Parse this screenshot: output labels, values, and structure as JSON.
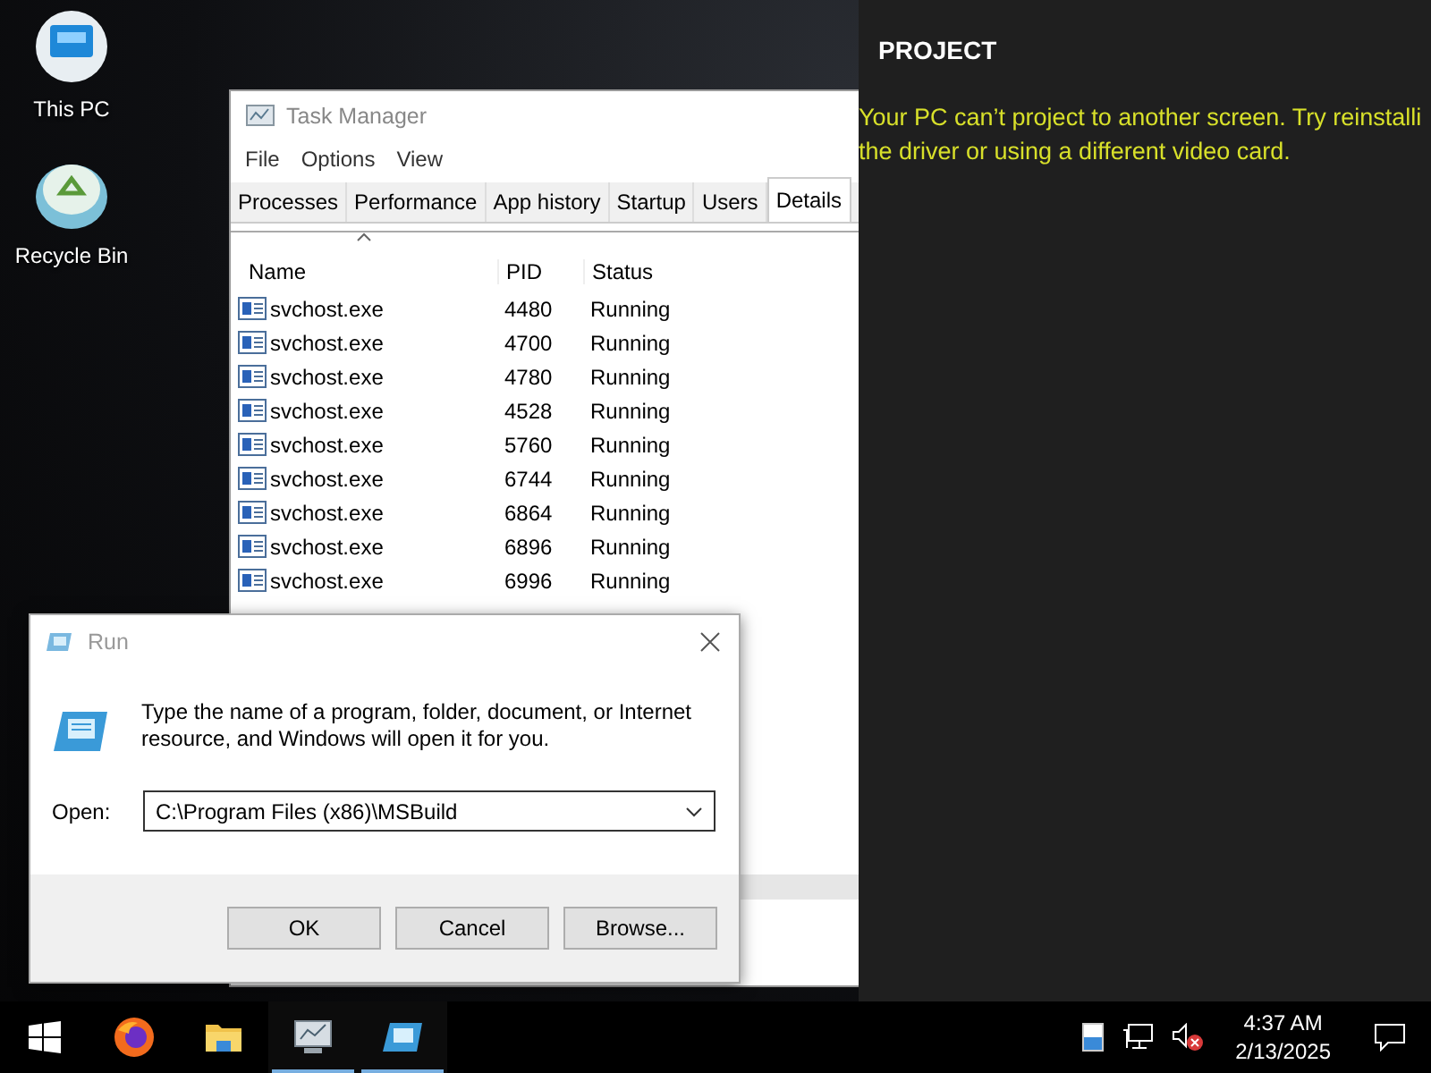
{
  "desktop_icons": [
    {
      "kind": "computer",
      "label": "This PC"
    },
    {
      "kind": "recycle",
      "label": "Recycle Bin"
    }
  ],
  "task_manager": {
    "title": "Task Manager",
    "menu": [
      "File",
      "Options",
      "View"
    ],
    "tabs": [
      {
        "label": "Processes",
        "selected": false
      },
      {
        "label": "Performance",
        "selected": false
      },
      {
        "label": "App history",
        "selected": false
      },
      {
        "label": "Startup",
        "selected": false
      },
      {
        "label": "Users",
        "selected": false
      },
      {
        "label": "Details",
        "selected": true
      }
    ],
    "columns": [
      "Name",
      "PID",
      "Status"
    ],
    "rows": [
      {
        "name": "svchost.exe",
        "pid": "4480",
        "status": "Running"
      },
      {
        "name": "svchost.exe",
        "pid": "4700",
        "status": "Running"
      },
      {
        "name": "svchost.exe",
        "pid": "4780",
        "status": "Running"
      },
      {
        "name": "svchost.exe",
        "pid": "4528",
        "status": "Running"
      },
      {
        "name": "svchost.exe",
        "pid": "5760",
        "status": "Running"
      },
      {
        "name": "svchost.exe",
        "pid": "6744",
        "status": "Running"
      },
      {
        "name": "svchost.exe",
        "pid": "6864",
        "status": "Running"
      },
      {
        "name": "svchost.exe",
        "pid": "6896",
        "status": "Running"
      },
      {
        "name": "svchost.exe",
        "pid": "6996",
        "status": "Running"
      }
    ]
  },
  "project_panel": {
    "title": "PROJECT",
    "message_lines": [
      "Your PC can’t project to another screen. Try reinstalli",
      "the driver or using a different video card."
    ]
  },
  "run_dialog": {
    "title": "Run",
    "description": "Type the name of a program, folder, document, or Internet resource, and Windows will open it for you.",
    "open_label": "Open:",
    "open_value": "C:\\Program Files (x86)\\MSBuild",
    "buttons": [
      "OK",
      "Cancel",
      "Browse..."
    ]
  },
  "taskbar": {
    "apps": [
      {
        "kind": "start",
        "running": false
      },
      {
        "kind": "browser",
        "running": false
      },
      {
        "kind": "folder",
        "running": false
      },
      {
        "kind": "monitor",
        "running": true
      },
      {
        "kind": "run",
        "running": true
      }
    ],
    "tray": [
      {
        "kind": "battery"
      },
      {
        "kind": "network"
      },
      {
        "kind": "volume-muted"
      }
    ],
    "time": "4:37 AM",
    "date": "2/13/2025"
  }
}
